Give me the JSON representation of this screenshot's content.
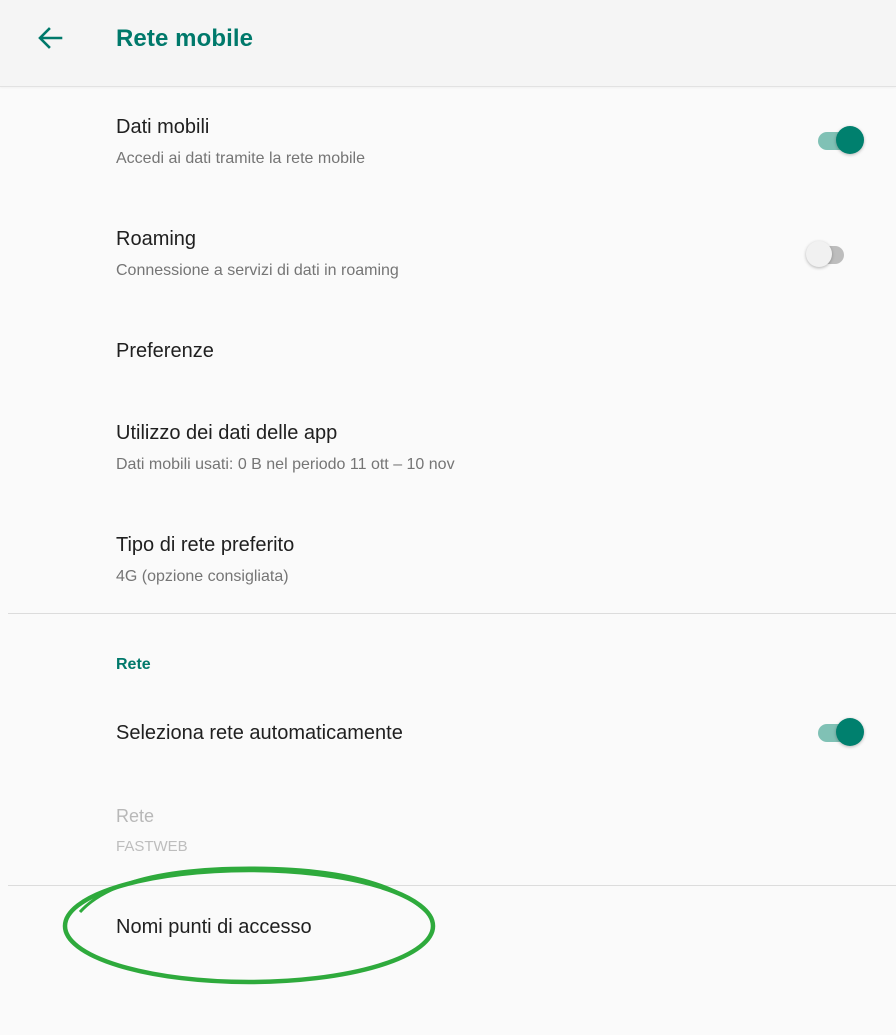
{
  "appbar": {
    "title": "Rete mobile",
    "back_icon": "arrow-left-icon"
  },
  "colors": {
    "accent": "#00796b",
    "switch_on_thumb": "#00806e",
    "switch_on_track": "#80c1b5",
    "annotation": "#2eaa3c"
  },
  "settings": {
    "mobile_data": {
      "title": "Dati mobili",
      "summary": "Accedi ai dati tramite la rete mobile",
      "enabled": true
    },
    "roaming": {
      "title": "Roaming",
      "summary": "Connessione a servizi di dati in roaming",
      "enabled": false
    },
    "preferences": {
      "title": "Preferenze"
    },
    "app_data_usage": {
      "title": "Utilizzo dei dati delle app",
      "summary": "Dati mobili usati: 0 B nel periodo 11 ott – 10 nov"
    },
    "preferred_network_type": {
      "title": "Tipo di rete preferito",
      "summary": "4G (opzione consigliata)"
    }
  },
  "network_section": {
    "header": "Rete",
    "auto_select": {
      "title": "Seleziona rete automaticamente",
      "enabled": true
    },
    "network": {
      "title": "Rete",
      "summary": "FASTWEB"
    }
  },
  "apn": {
    "title": "Nomi punti di accesso"
  }
}
